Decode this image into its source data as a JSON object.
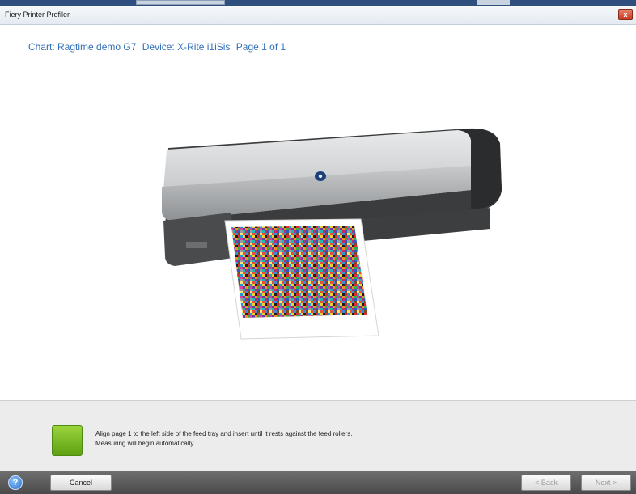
{
  "window": {
    "title": "Fiery Printer Profiler",
    "close_label": "x"
  },
  "header": {
    "chart_label": "Chart: Ragtime demo G7",
    "device_label": "Device: X-Rite i1iSis",
    "page_label": "Page 1 of 1"
  },
  "instruction": {
    "line1": "Align page 1 to the left side of the feed tray and insert until it rests against the feed rollers.",
    "line2": "Measuring will begin automatically."
  },
  "footer": {
    "help_label": "?",
    "cancel_label": "Cancel",
    "back_label": "< Back",
    "next_label": "Next >"
  },
  "colors": {
    "header_text": "#3270b8",
    "status_indicator": "#7cc21f",
    "footer_bg": "#4f4f4f"
  },
  "icons": {
    "help": "help-icon",
    "close": "close-icon"
  }
}
